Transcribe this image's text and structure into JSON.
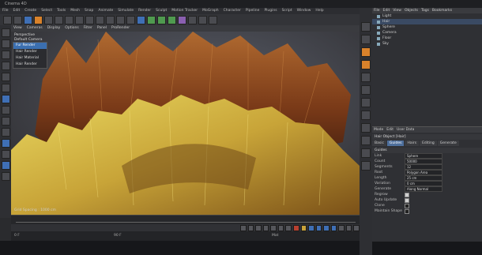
{
  "app": {
    "title": "Cinema 4D"
  },
  "menubar": {
    "items": [
      "File",
      "Edit",
      "Create",
      "Select",
      "Tools",
      "Mesh",
      "Snap",
      "Animate",
      "Simulate",
      "Render",
      "Sculpt",
      "Motion Tracker",
      "MoGraph",
      "Character",
      "Pipeline",
      "Plugins",
      "Script",
      "Window",
      "Help"
    ]
  },
  "viewport": {
    "menu": [
      "View",
      "Cameras",
      "Display",
      "Options",
      "Filter",
      "Panel",
      "ProRender"
    ],
    "hud_lines": [
      "Perspective",
      "Default Camera"
    ],
    "context_menu": [
      {
        "label": "Fur Render",
        "selected": true
      },
      {
        "label": "Hair Render",
        "selected": false
      },
      {
        "label": "Hair Material",
        "selected": false
      },
      {
        "label": "Hair Render",
        "selected": false
      }
    ],
    "grid_label": "Grid Spacing : 1000 cm"
  },
  "timeline": {
    "start": "0 F",
    "end": "90 F",
    "current": "0 F"
  },
  "bottom": {
    "left": "0 F",
    "mid": "90 F",
    "right": "Mat"
  },
  "object_manager": {
    "menu": [
      "File",
      "Edit",
      "View",
      "Objects",
      "Tags",
      "Bookmarks"
    ],
    "objects": [
      {
        "name": "Light",
        "selected": false
      },
      {
        "name": "Hair",
        "selected": true
      },
      {
        "name": "Sphere",
        "selected": false
      },
      {
        "name": "Camera",
        "selected": false
      },
      {
        "name": "Floor",
        "selected": false
      },
      {
        "name": "Sky",
        "selected": false
      }
    ]
  },
  "attributes": {
    "menu": [
      "Mode",
      "Edit",
      "User Data"
    ],
    "header": "Hair Object [Hair]",
    "tabs": [
      {
        "label": "Basic",
        "active": false
      },
      {
        "label": "Guides",
        "active": true
      },
      {
        "label": "Hairs",
        "active": false
      },
      {
        "label": "Editing",
        "active": false
      },
      {
        "label": "Generate",
        "active": false
      }
    ],
    "section": "Guides",
    "fields": [
      {
        "label": "Link",
        "value": "Sphere"
      },
      {
        "label": "Count",
        "value": "50000"
      },
      {
        "label": "Segments",
        "value": "12"
      },
      {
        "label": "Root",
        "value": "Polygon Area"
      },
      {
        "label": "Length",
        "value": "25 cm"
      },
      {
        "label": "Variation",
        "value": "0 cm"
      },
      {
        "label": "Generate",
        "value": "Along Normal"
      }
    ],
    "checks": [
      {
        "label": "Regrow",
        "on": true
      },
      {
        "label": "Auto Update",
        "on": true
      },
      {
        "label": "Clone",
        "on": false
      },
      {
        "label": "Maintain Shape",
        "on": false
      }
    ]
  },
  "colors": {
    "accent": "#3b6fb0",
    "fur": "#d8c040",
    "fur_shadow": "#6a3418",
    "bg": "#2a2b2e"
  }
}
